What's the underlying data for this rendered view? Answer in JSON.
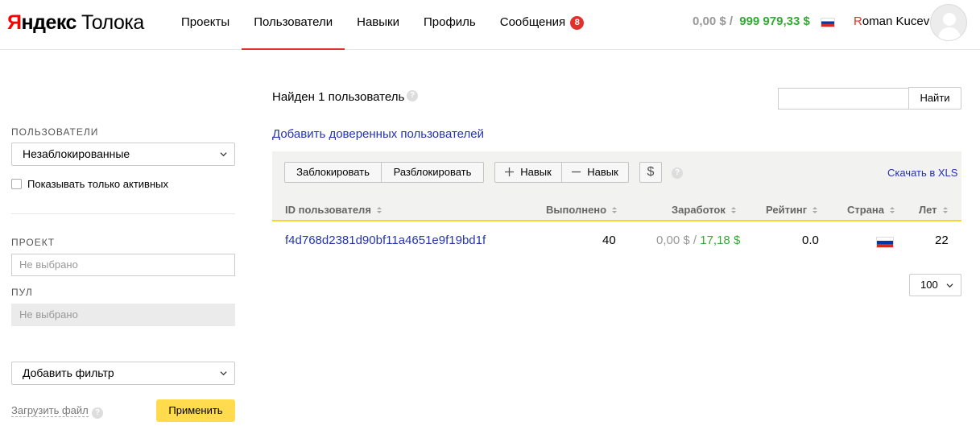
{
  "header": {
    "logo_yandex": "Яндекс",
    "logo_toloka": "Толока",
    "nav": [
      {
        "label": "Проекты",
        "active": false
      },
      {
        "label": "Пользователи",
        "active": true
      },
      {
        "label": "Навыки",
        "active": false
      },
      {
        "label": "Профиль",
        "active": false
      },
      {
        "label": "Сообщения",
        "active": false
      }
    ],
    "messages_count": "8",
    "balance_left": "0,00 $",
    "balance_sep": "/",
    "balance_right": "999 979,33 $",
    "user_initial": "R",
    "user_rest": "oman Kucev"
  },
  "sidebar": {
    "users_label": "ПОЛЬЗОВАТЕЛИ",
    "users_filter_value": "Незаблокированные",
    "show_active_label": "Показывать только активных",
    "project_label": "ПРОЕКТ",
    "project_placeholder": "Не выбрано",
    "pool_label": "ПУЛ",
    "pool_placeholder": "Не выбрано",
    "add_filter_value": "Добавить фильтр",
    "upload_label": "Загрузить файл",
    "apply_label": "Применить"
  },
  "main": {
    "found_text": "Найден 1 пользователь",
    "search_button": "Найти",
    "add_trusted_link": "Добавить доверенных пользователей",
    "toolbar": {
      "block": "Заблокировать",
      "unblock": "Разблокировать",
      "add_skill": "Навык",
      "remove_skill": "Навык",
      "dollar": "$",
      "download": "Скачать в XLS"
    },
    "table": {
      "columns": {
        "id": "ID пользователя",
        "done": "Выполнено",
        "earned": "Заработок",
        "rating": "Рейтинг",
        "country": "Страна",
        "age": "Лет"
      },
      "rows": [
        {
          "id": "f4d768d2381d90bf11a4651e9f19bd1f",
          "done": "40",
          "earned_left": "0,00 $",
          "earned_sep": "/",
          "earned_right": "17,18 $",
          "rating": "0.0",
          "age": "22"
        }
      ]
    },
    "page_size": "100"
  },
  "colors": {
    "accent_red": "#e2312a",
    "link_blue": "#2435b0",
    "money_green": "#33aa33",
    "button_yellow": "#ffdb4d",
    "table_header_line": "#ffd233"
  }
}
